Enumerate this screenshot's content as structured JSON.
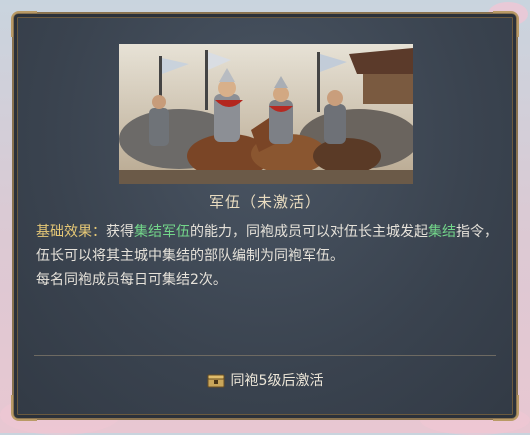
{
  "card": {
    "title": "军伍（未激活）",
    "effect_label": "基础效果：",
    "effect_parts": {
      "p1": "获得",
      "hl1": "集结军伍",
      "p2": "的能力，同袍成员可以对伍长主城发起",
      "hl2": "集结",
      "p3": "指令，伍长可以将其主城中集结的部队编制为同袍军伍。"
    },
    "extra_line": "每名同袍成员每日可集结2次。",
    "unlock_condition": "同袍5级后激活",
    "lock_icon": "chest-icon"
  },
  "colors": {
    "label": "#e6c876",
    "highlight": "#73d68a",
    "text": "#e6e2da"
  }
}
